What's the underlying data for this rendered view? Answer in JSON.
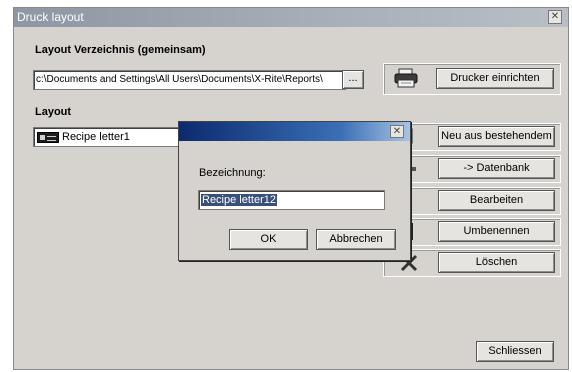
{
  "window": {
    "title": "Druck layout",
    "close_glyph": "✕"
  },
  "layout_dir": {
    "label": "Layout Verzeichnis (gemeinsam)",
    "path_value": "c:\\Documents and Settings\\All Users\\Documents\\X-Rite\\Reports\\",
    "browse_label": "..."
  },
  "printer": {
    "button_label": "Drucker einrichten",
    "icon": "printer-icon"
  },
  "layout": {
    "label": "Layout",
    "selected_item": "Recipe letter1",
    "item_icon": "layout-item-icon"
  },
  "actions": [
    {
      "label": "Neu aus bestehendem",
      "icon": "new-copy-icon"
    },
    {
      "label": "-> Datenbank",
      "icon": "database-icon"
    },
    {
      "label": "Bearbeiten",
      "icon": "edit-icon"
    },
    {
      "label": "Umbenennen",
      "icon": "rename-icon"
    },
    {
      "label": "Löschen",
      "icon": "delete-icon"
    }
  ],
  "close_button_label": "Schliessen",
  "dialog": {
    "title": "",
    "field_label": "Bezeichnung:",
    "field_value": "Recipe letter12",
    "ok_label": "OK",
    "cancel_label": "Abbrechen",
    "close_glyph": "✕"
  }
}
